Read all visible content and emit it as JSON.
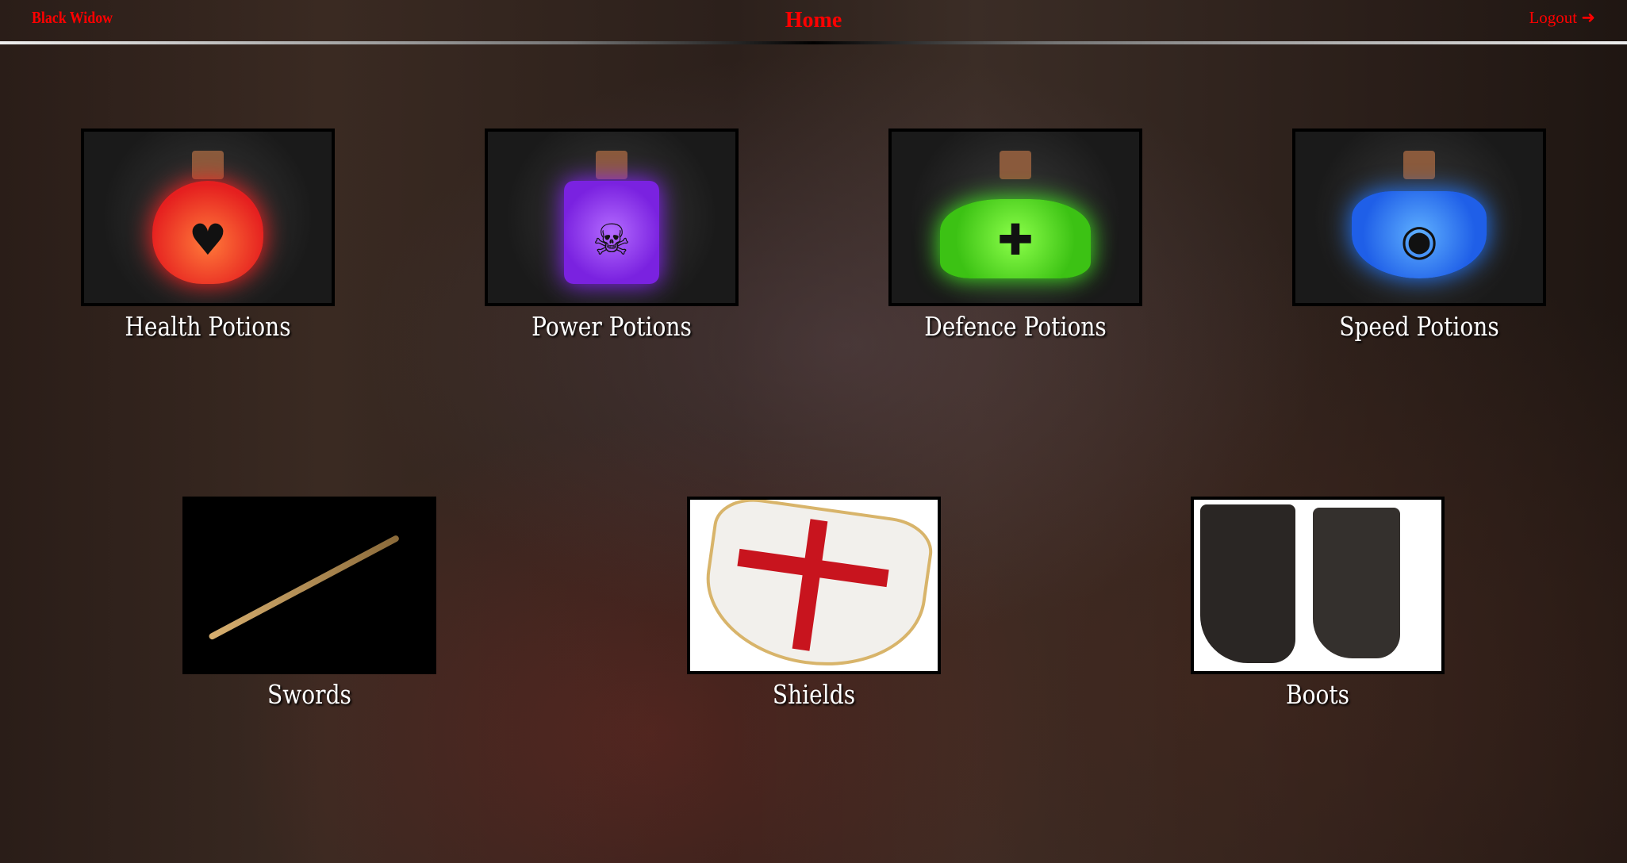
{
  "nav": {
    "brand": "Black Widow",
    "title": "Home",
    "logout": "Logout",
    "logout_icon": "sign-out-icon"
  },
  "categories": [
    {
      "label": "Health Potions",
      "color": "#ff3b2a",
      "symbol": "♥"
    },
    {
      "label": "Power Potions",
      "color": "#9b3cff",
      "symbol": "☠"
    },
    {
      "label": "Defence Potions",
      "color": "#52e022",
      "symbol": "✚"
    },
    {
      "label": "Speed Potions",
      "color": "#2a7dff",
      "symbol": "◉"
    },
    {
      "label": "Swords"
    },
    {
      "label": "Shields"
    },
    {
      "label": "Boots"
    }
  ]
}
